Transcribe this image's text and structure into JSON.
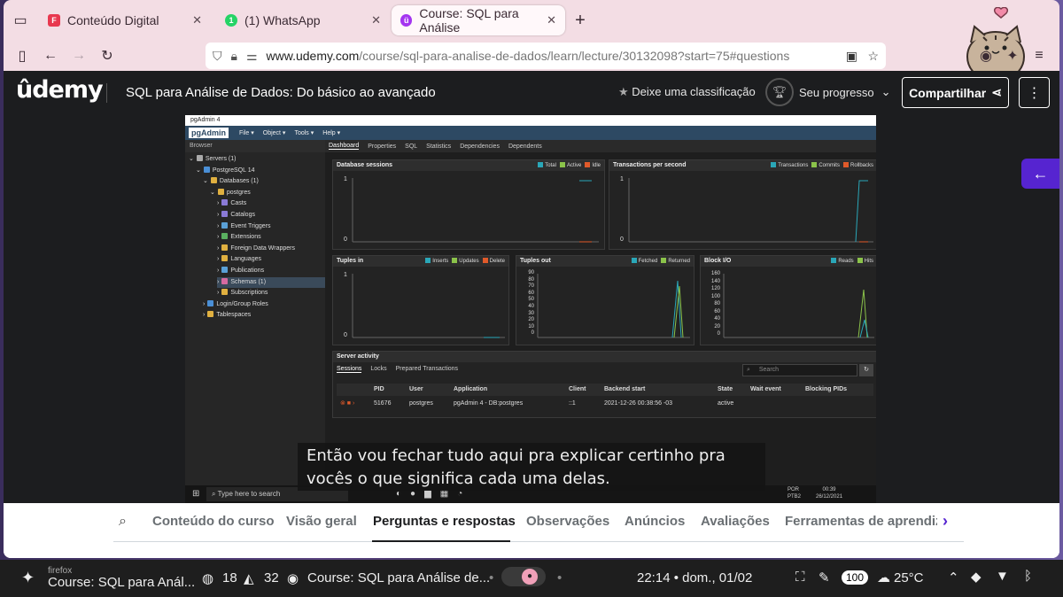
{
  "browser": {
    "tabs": [
      {
        "label": "Conteúdo Digital",
        "favicon": "F",
        "color": "#e8384f"
      },
      {
        "label": "(1) WhatsApp",
        "favicon": "1",
        "color": "#25d366"
      },
      {
        "label": "Course: SQL para Análise",
        "favicon": "ü",
        "color": "#a435f0"
      }
    ],
    "url_host": "www.udemy.com",
    "url_path": "/course/sql-para-analise-de-dados/learn/lecture/30132098?start=75#questions"
  },
  "udemy": {
    "logo": "ûdemy",
    "course_title": "SQL para Análise de Dados: Do básico ao avançado",
    "rate_label": "Deixe uma classificação",
    "progress_label": "Seu progresso",
    "share_label": "Compartilhar"
  },
  "pgadmin": {
    "window_title": "pgAdmin 4",
    "logo": "pgAdmin",
    "menu": [
      "File ▾",
      "Object ▾",
      "Tools ▾",
      "Help ▾"
    ],
    "browser_label": "Browser",
    "tabs": [
      "Dashboard",
      "Properties",
      "SQL",
      "Statistics",
      "Dependencies",
      "Dependents"
    ],
    "tree": [
      {
        "label": "Servers (1)",
        "lvl": 0,
        "c": "#aaa",
        "arrow": "⌄"
      },
      {
        "label": "PostgreSQL 14",
        "lvl": 1,
        "c": "#4a8fd6",
        "arrow": "⌄"
      },
      {
        "label": "Databases (1)",
        "lvl": 2,
        "c": "#e0b040",
        "arrow": "⌄"
      },
      {
        "label": "postgres",
        "lvl": 3,
        "c": "#e0b040",
        "arrow": "⌄"
      },
      {
        "label": "Casts",
        "lvl": 4,
        "c": "#8a7ad6",
        "arrow": "›"
      },
      {
        "label": "Catalogs",
        "lvl": 4,
        "c": "#8a7ad6",
        "arrow": "›"
      },
      {
        "label": "Event Triggers",
        "lvl": 4,
        "c": "#5aa0d6",
        "arrow": "›"
      },
      {
        "label": "Extensions",
        "lvl": 4,
        "c": "#5ab060",
        "arrow": "›"
      },
      {
        "label": "Foreign Data Wrappers",
        "lvl": 4,
        "c": "#e0b040",
        "arrow": "›"
      },
      {
        "label": "Languages",
        "lvl": 4,
        "c": "#e0b040",
        "arrow": "›"
      },
      {
        "label": "Publications",
        "lvl": 4,
        "c": "#5aa0d6",
        "arrow": "›"
      },
      {
        "label": "Schemas (1)",
        "lvl": 4,
        "c": "#d66aa0",
        "arrow": "›"
      },
      {
        "label": "Subscriptions",
        "lvl": 4,
        "c": "#e0b040",
        "arrow": "›"
      },
      {
        "label": "Login/Group Roles",
        "lvl": 2,
        "c": "#4a8fd6",
        "arrow": "›"
      },
      {
        "label": "Tablespaces",
        "lvl": 2,
        "c": "#e0b040",
        "arrow": "›"
      }
    ],
    "panels": {
      "sessions": {
        "title": "Database sessions",
        "legend": [
          "Total",
          "Active",
          "Idle"
        ],
        "ymax": "1",
        "ymin": "0"
      },
      "tps": {
        "title": "Transactions per second",
        "legend": [
          "Transactions",
          "Commits",
          "Rollbacks"
        ],
        "ymax": "1",
        "ymin": "0"
      },
      "tuples_in": {
        "title": "Tuples in",
        "legend": [
          "Inserts",
          "Updates",
          "Delete"
        ],
        "ymax": "1",
        "ymin": "0"
      },
      "tuples_out": {
        "title": "Tuples out",
        "legend": [
          "Fetched",
          "Returned"
        ],
        "yticks": [
          "90",
          "80",
          "70",
          "60",
          "50",
          "40",
          "30",
          "20",
          "10",
          "0"
        ]
      },
      "block_io": {
        "title": "Block I/O",
        "legend": [
          "Reads",
          "Hits"
        ],
        "yticks": [
          "160",
          "140",
          "120",
          "100",
          "80",
          "60",
          "40",
          "20",
          "0"
        ]
      }
    },
    "server_activity": {
      "title": "Server activity",
      "tabs": [
        "Sessions",
        "Locks",
        "Prepared Transactions"
      ],
      "search_placeholder": "Search",
      "columns": [
        "PID",
        "User",
        "Application",
        "Client",
        "Backend start",
        "State",
        "Wait event",
        "Blocking PIDs"
      ],
      "row": [
        "51676",
        "postgres",
        "pgAdmin 4 - DB:postgres",
        "::1",
        "2021-12-26 00:38:56 -03",
        "active",
        "",
        ""
      ]
    },
    "taskbar": {
      "search": "Type here to search",
      "lang": "POR\nPTB2",
      "time": "00:39",
      "date": "26/12/2021"
    }
  },
  "subtitle": "Então vou fechar tudo aqui pra explicar certinho pra vocês o que significa cada uma delas.",
  "lecture_nav": [
    "Conteúdo do curso",
    "Visão geral",
    "Perguntas e respostas",
    "Observações",
    "Anúncios",
    "Avaliações",
    "Ferramentas de aprendiz"
  ],
  "panel": {
    "app_small": "firefox",
    "app_title": "Course: SQL para Anál...",
    "count1": "18",
    "count2": "32",
    "media_title": "Course: SQL para Análise de...",
    "clock": "22:14 • dom., 01/02",
    "battery": "100",
    "weather": "25°C"
  }
}
